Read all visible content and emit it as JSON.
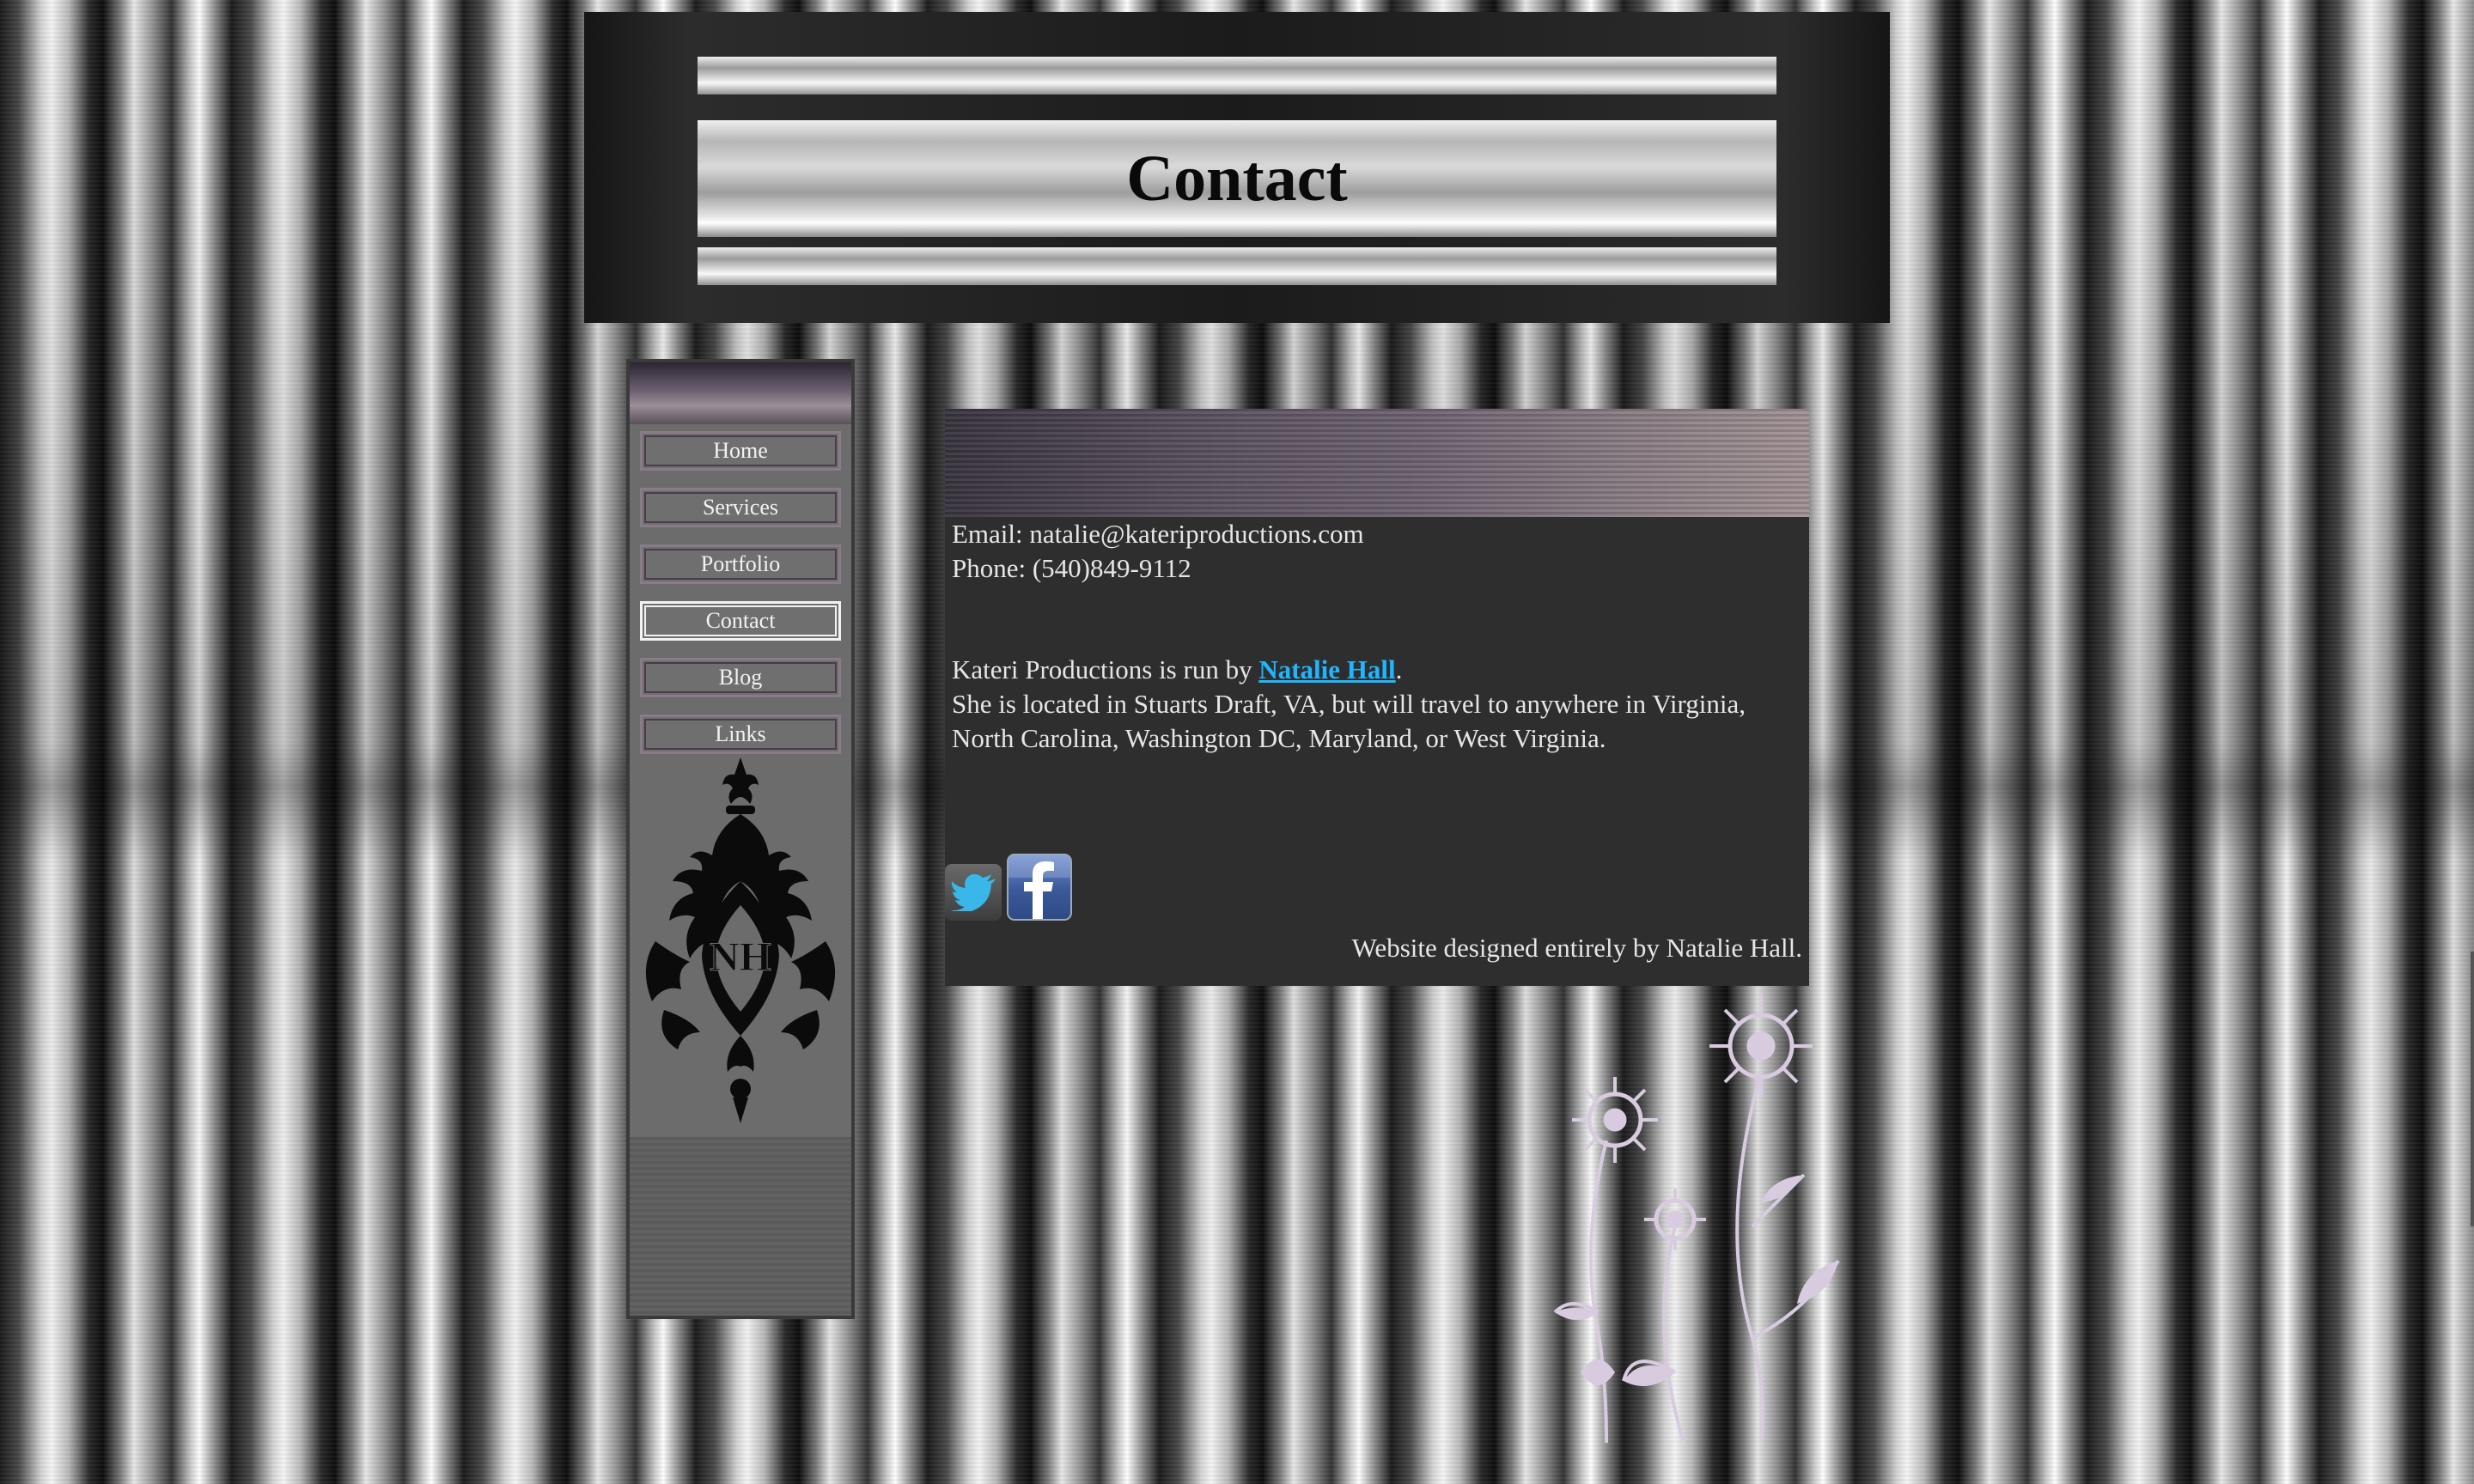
{
  "header": {
    "title": "Contact"
  },
  "sidebar": {
    "nav": [
      {
        "label": "Home",
        "active": false
      },
      {
        "label": "Services",
        "active": false
      },
      {
        "label": "Portfolio",
        "active": false
      },
      {
        "label": "Contact",
        "active": true
      },
      {
        "label": "Blog",
        "active": false
      },
      {
        "label": "Links",
        "active": false
      }
    ],
    "monogram_text": "NH"
  },
  "contact": {
    "email_line": "Email: natalie@kateriproductions.com",
    "phone_line": "Phone: (540)849-9112",
    "run_by_prefix": "Kateri Productions is run by ",
    "run_by_link": "Natalie Hall",
    "run_by_suffix": ".",
    "location_text": "She is located in Stuarts Draft, VA, but will travel to anywhere in Virginia, North Carolina, Washington DC, Maryland, or West Virginia.",
    "credit": "Website designed entirely by Natalie Hall."
  },
  "social": {
    "icons": [
      "twitter-icon",
      "facebook-icon"
    ]
  },
  "colors": {
    "panel": "#2e2e2e",
    "link": "#1fb6ff",
    "text": "#e6e6e6",
    "nav_button": "#6f6f6f",
    "facebook_blue": "#3b5998"
  }
}
